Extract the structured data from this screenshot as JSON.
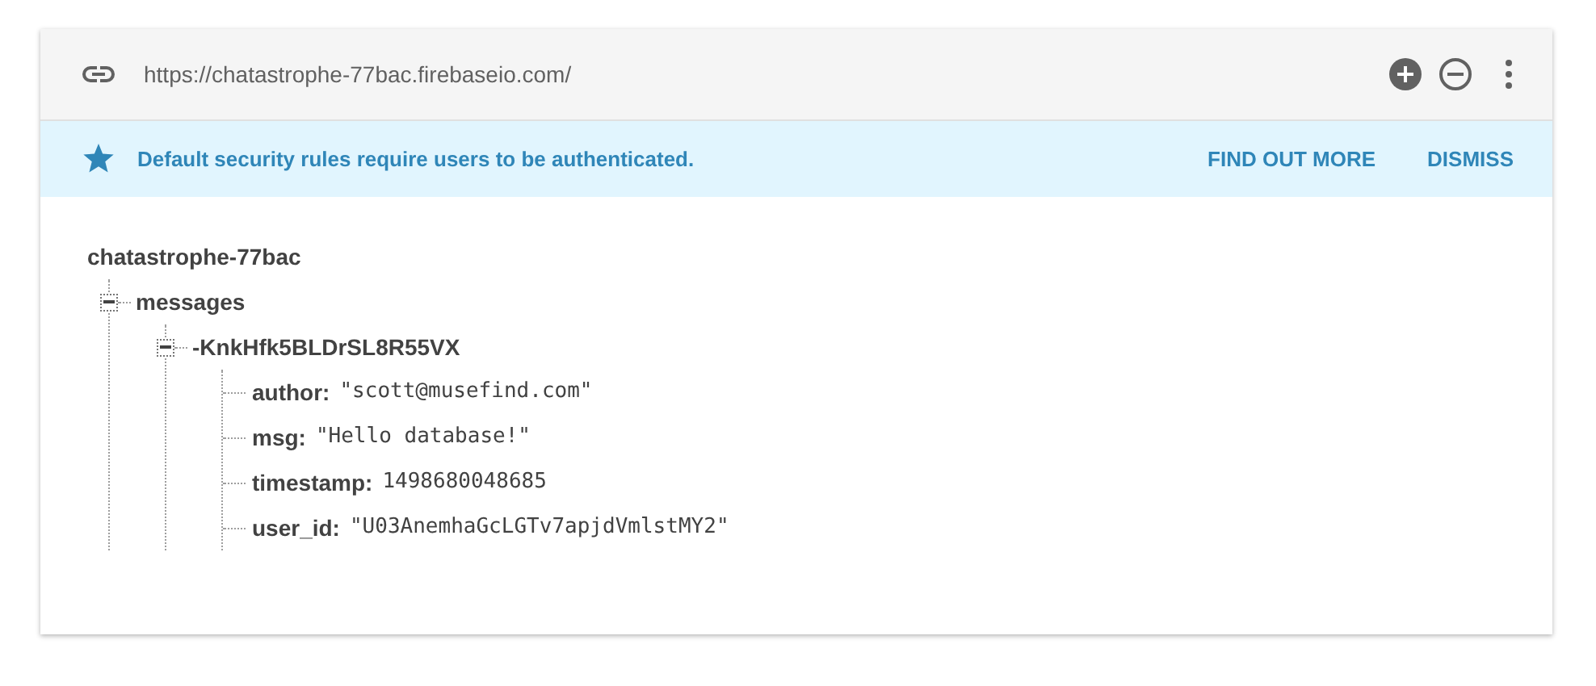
{
  "header": {
    "url": "https://chatastrophe-77bac.firebaseio.com/"
  },
  "banner": {
    "message": "Default security rules require users to be authenticated.",
    "actions": [
      "FIND OUT MORE",
      "DISMISS"
    ]
  },
  "tree": {
    "key": "chatastrophe-77bac",
    "children": [
      {
        "key": "messages",
        "expanded": true,
        "children": [
          {
            "key": "-KnkHfk5BLDrSL8R55VX",
            "expanded": true,
            "children": [
              {
                "key": "author:",
                "value": "\"scott@musefind.com\""
              },
              {
                "key": "msg:",
                "value": "\"Hello database!\""
              },
              {
                "key": "timestamp:",
                "value": "1498680048685"
              },
              {
                "key": "user_id:",
                "value": "\"U03AnemhaGcLGTv7apjdVmlstMY2\""
              }
            ]
          }
        ]
      }
    ]
  }
}
